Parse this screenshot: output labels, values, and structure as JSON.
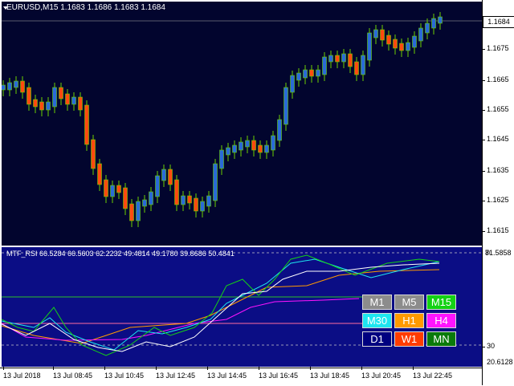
{
  "main_chart": {
    "title": "EURUSD,M15  1.1683 1.1686 1.1683 1.1684",
    "current_price": "1.1684",
    "price_labels": [
      "1.1675",
      "1.1665",
      "1.1655",
      "1.1645",
      "1.1635",
      "1.1625",
      "1.1615"
    ],
    "colors": {
      "background": "#02052e",
      "bull": "#2a6ad8",
      "bear": "#ff4a10",
      "wick": "#6cd000",
      "bid_line": "#b0b0b0"
    }
  },
  "indicator": {
    "title": "MTF_RSI 66.5284 66.5603 62.2232 49.4814 49.1780 39.8686 50.4841",
    "levels": [
      "70",
      "30"
    ],
    "range_labels": [
      "81.5858",
      "20.6128"
    ],
    "buttons": [
      {
        "label": "M1",
        "bg": "#8c8c8c",
        "fg": "#ffffff"
      },
      {
        "label": "M5",
        "bg": "#8c8c8c",
        "fg": "#ffffff"
      },
      {
        "label": "M15",
        "bg": "#14d214",
        "fg": "#ffffff"
      },
      {
        "label": "M30",
        "bg": "#1ee6f0",
        "fg": "#ffffff"
      },
      {
        "label": "H1",
        "bg": "#ff9a00",
        "fg": "#ffffff"
      },
      {
        "label": "H4",
        "bg": "#ff14ff",
        "fg": "#ffffff"
      },
      {
        "label": "D1",
        "bg": "#000080",
        "fg": "#ffffff"
      },
      {
        "label": "W1",
        "bg": "#ff3c00",
        "fg": "#ffffff"
      },
      {
        "label": "MN",
        "bg": "#0a7a0a",
        "fg": "#ffffff"
      }
    ]
  },
  "time_labels": [
    "13 Jul 2018",
    "13 Jul 08:45",
    "13 Jul 10:45",
    "13 Jul 12:45",
    "13 Jul 14:45",
    "13 Jul 16:45",
    "13 Jul 18:45",
    "13 Jul 20:45",
    "13 Jul 22:45"
  ]
}
